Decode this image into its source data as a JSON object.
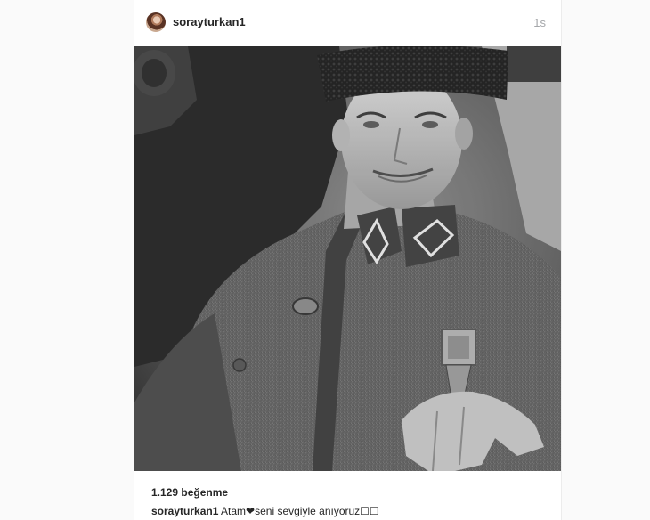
{
  "post": {
    "username": "sorayturkan1",
    "timestamp": "1s",
    "likes": "1.129 beğenme",
    "caption": {
      "username": "sorayturkan1",
      "text": " Atam❤seni sevgiyle anıyoruz☐☐"
    }
  },
  "icons": {
    "avatar": "profile-photo",
    "heart": "heart-icon"
  },
  "colors": {
    "background": "#fafafa",
    "card": "#ffffff",
    "text": "#262626",
    "muted": "#a5a7aa"
  }
}
